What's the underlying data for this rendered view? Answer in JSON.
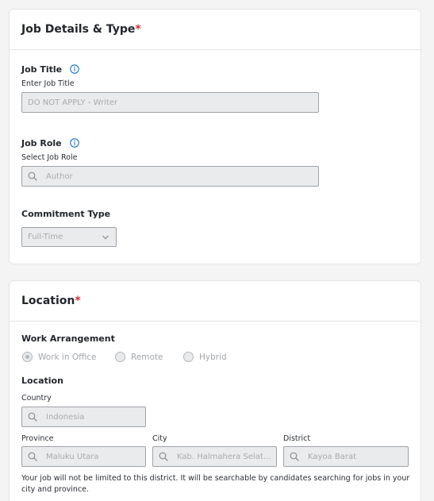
{
  "job_details": {
    "title": "Job Details & Type",
    "required_mark": "*",
    "job_title": {
      "label": "Job Title",
      "sublabel": "Enter Job Title",
      "value": "DO NOT APPLY - Writer"
    },
    "job_role": {
      "label": "Job Role",
      "sublabel": "Select Job Role",
      "value": "Author"
    },
    "commitment": {
      "label": "Commitment Type",
      "value": "Full-Time"
    }
  },
  "location": {
    "title": "Location",
    "required_mark": "*",
    "work_arrangement": {
      "label": "Work Arrangement",
      "options": [
        "Work in Office",
        "Remote",
        "Hybrid"
      ],
      "selected": "Work in Office"
    },
    "section_label": "Location",
    "country": {
      "label": "Country",
      "value": "Indonesia"
    },
    "province": {
      "label": "Province",
      "value": "Maluku Utara"
    },
    "city": {
      "label": "City",
      "value": "Kab. Halmahera Selatan"
    },
    "district": {
      "label": "District",
      "value": "Kayoa Barat"
    },
    "help_text": "Your job will not be limited to this district. It will be searchable by candidates searching for jobs in your city and province."
  },
  "colors": {
    "required": "#d92d3b",
    "info_icon": "#1a6fc4"
  },
  "icons": {
    "info": "info-icon",
    "search": "search-icon",
    "dropdown": "chevron-down-icon"
  }
}
